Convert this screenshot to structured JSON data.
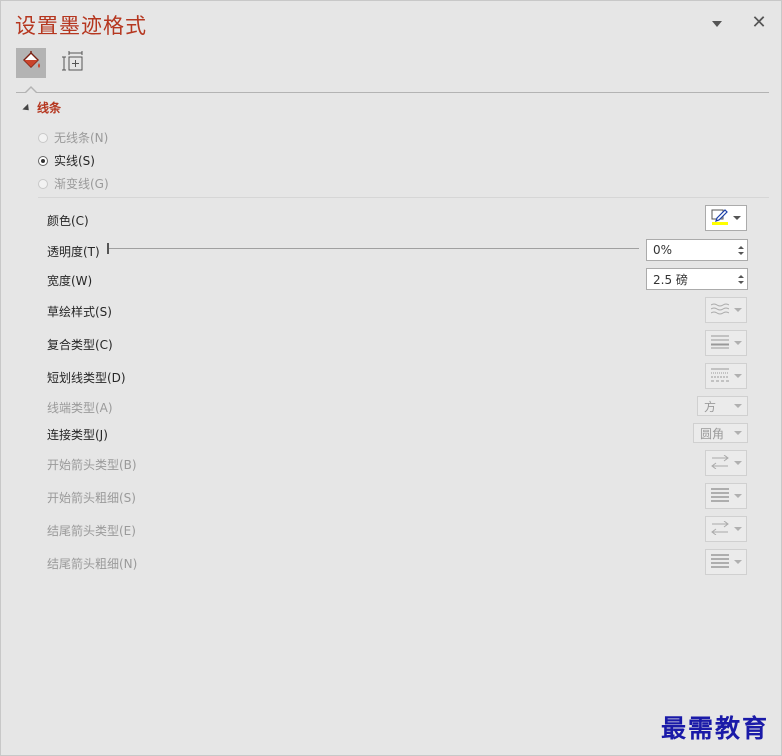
{
  "pane": {
    "title": "设置墨迹格式",
    "dropdown_icon": "chevron-down-icon",
    "close_icon": "close-icon",
    "close_glyph": "✕"
  },
  "tabs": [
    {
      "name": "fill-line",
      "icon": "paint-bucket-icon",
      "active": true
    },
    {
      "name": "size-properties",
      "icon": "size-position-icon",
      "active": false
    }
  ],
  "section": {
    "label": "线条",
    "expanded": true
  },
  "line_options": [
    {
      "label": "无线条(N)",
      "checked": false,
      "enabled": false
    },
    {
      "label": "实线(S)",
      "checked": true,
      "enabled": true
    },
    {
      "label": "渐变线(G)",
      "checked": false,
      "enabled": false
    }
  ],
  "props": {
    "color": {
      "label": "颜色(C)",
      "swatch": "#ffff00"
    },
    "transparency": {
      "label": "透明度(T)",
      "value": "0%",
      "level_percent": 0
    },
    "width": {
      "label": "宽度(W)",
      "value": "2.5 磅"
    },
    "sketch_style": {
      "label": "草绘样式(S)"
    },
    "compound_type": {
      "label": "复合类型(C)"
    },
    "dash_type": {
      "label": "短划线类型(D)"
    },
    "cap_type": {
      "label": "线端类型(A)",
      "value": "方"
    },
    "join_type": {
      "label": "连接类型(J)",
      "value": "圆角"
    },
    "begin_arrow_type": {
      "label": "开始箭头类型(B)"
    },
    "begin_arrow_size": {
      "label": "开始箭头粗细(S)"
    },
    "end_arrow_type": {
      "label": "结尾箭头类型(E)"
    },
    "end_arrow_size": {
      "label": "结尾箭头粗细(N)"
    }
  },
  "watermark": "最需教育",
  "colors": {
    "accent": "#b5361f",
    "pane_bg": "#e6e6e6",
    "disabled_text": "#9a9a9a",
    "watermark": "#1a1aa8"
  }
}
